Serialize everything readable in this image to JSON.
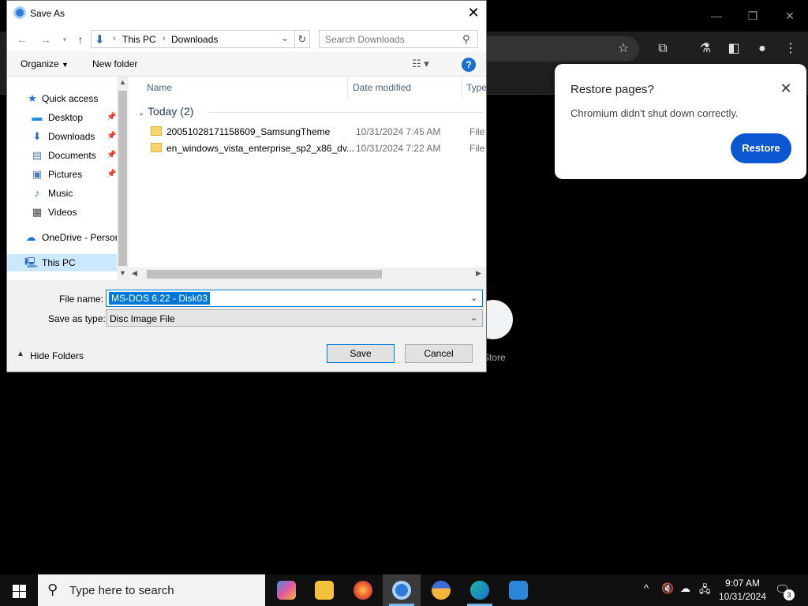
{
  "dialog": {
    "title": "Save As",
    "address": {
      "root": "This PC",
      "folder": "Downloads"
    },
    "search_placeholder": "Search Downloads",
    "commands": {
      "organize": "Organize",
      "new_folder": "New folder"
    },
    "nav": [
      {
        "label": "Quick access",
        "icon": "star-icon"
      },
      {
        "label": "Desktop",
        "icon": "desktop-icon",
        "pinned": true
      },
      {
        "label": "Downloads",
        "icon": "download-icon",
        "pinned": true
      },
      {
        "label": "Documents",
        "icon": "documents-icon",
        "pinned": true
      },
      {
        "label": "Pictures",
        "icon": "pictures-icon",
        "pinned": true
      },
      {
        "label": "Music",
        "icon": "music-icon"
      },
      {
        "label": "Videos",
        "icon": "videos-icon"
      },
      {
        "label": "OneDrive - Persor",
        "icon": "cloud-icon"
      },
      {
        "label": "This PC",
        "icon": "computer-icon",
        "selected": true
      }
    ],
    "columns": {
      "name": "Name",
      "date": "Date modified",
      "type": "Type"
    },
    "group": "Today (2)",
    "files": [
      {
        "name": "20051028171158609_SamsungTheme",
        "date": "10/31/2024 7:45 AM",
        "type": "File fo"
      },
      {
        "name": "en_windows_vista_enterprise_sp2_x86_dv...",
        "date": "10/31/2024 7:22 AM",
        "type": "File fo"
      }
    ],
    "file_name_label": "File name:",
    "file_name_value": "MS-DOS 6.22 - Disk03",
    "save_type_label": "Save as type:",
    "save_type_value": "Disc Image File",
    "hide_folders": "Hide Folders",
    "save": "Save",
    "cancel": "Cancel"
  },
  "restore_bubble": {
    "title": "Restore pages?",
    "message": "Chromium didn't shut down correctly.",
    "button": "Restore"
  },
  "browser": {
    "shortcut_label": "Store"
  },
  "taskbar": {
    "search_placeholder": "Type here to search",
    "time": "9:07 AM",
    "date": "10/31/2024",
    "notification_count": "3"
  },
  "colors": {
    "accent": "#0078d7",
    "restore_button": "#0b57d0"
  }
}
